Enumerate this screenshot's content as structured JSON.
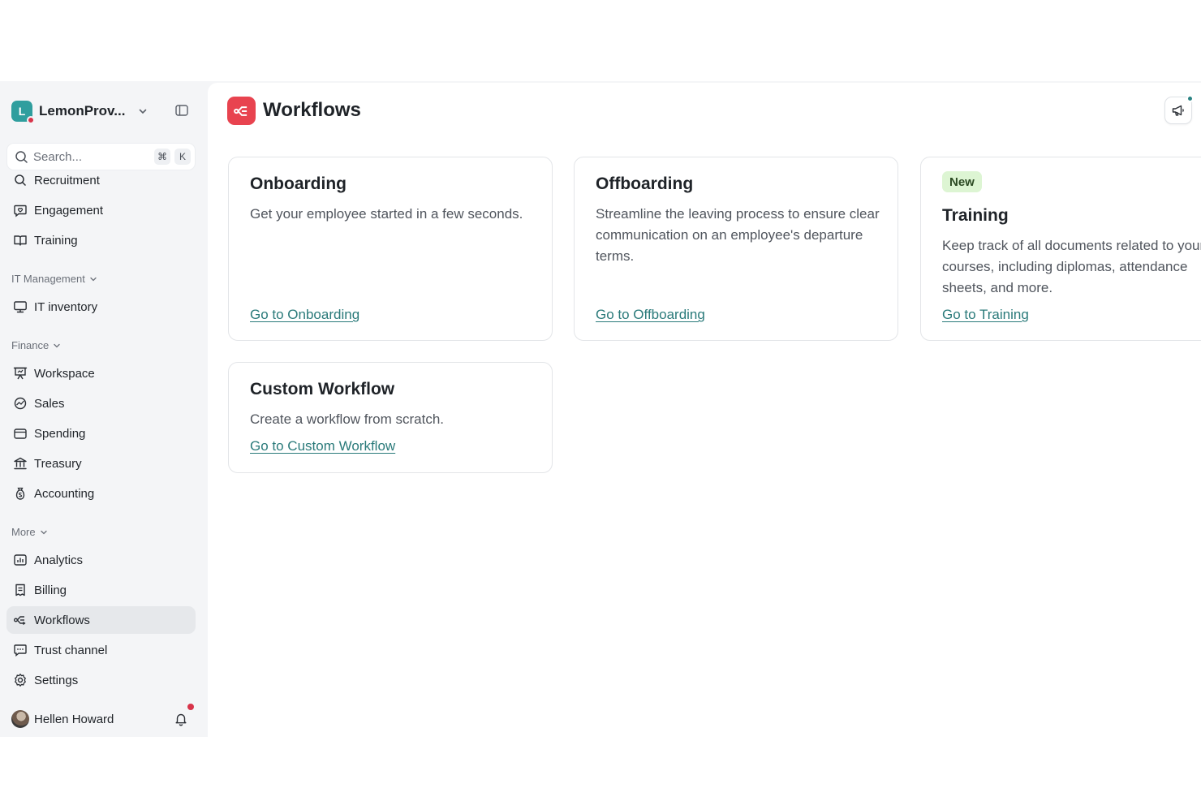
{
  "workspace": {
    "initial": "L",
    "name": "LemonProv..."
  },
  "search": {
    "placeholder": "Search...",
    "shortcut_cmd": "⌘",
    "shortcut_key": "K"
  },
  "sidebar": {
    "partial_item": {
      "label": "Recruitment",
      "icon": "recruitment-icon"
    },
    "items_top": [
      {
        "label": "Engagement",
        "icon": "engagement-icon"
      },
      {
        "label": "Training",
        "icon": "book-icon"
      }
    ],
    "sections": {
      "it_management": "IT Management",
      "finance": "Finance",
      "more": "More"
    },
    "it_items": [
      {
        "label": "IT inventory",
        "icon": "monitor-icon"
      }
    ],
    "finance_items": [
      {
        "label": "Workspace",
        "icon": "presentation-icon"
      },
      {
        "label": "Sales",
        "icon": "sales-icon"
      },
      {
        "label": "Spending",
        "icon": "wallet-icon"
      },
      {
        "label": "Treasury",
        "icon": "bank-icon"
      },
      {
        "label": "Accounting",
        "icon": "coin-icon"
      }
    ],
    "more_items": [
      {
        "label": "Analytics",
        "icon": "chart-icon"
      },
      {
        "label": "Billing",
        "icon": "receipt-icon"
      },
      {
        "label": "Workflows",
        "icon": "workflow-icon",
        "active": true
      },
      {
        "label": "Trust channel",
        "icon": "chat-icon"
      },
      {
        "label": "Settings",
        "icon": "gear-icon"
      }
    ]
  },
  "user": {
    "name": "Hellen Howard"
  },
  "page": {
    "title": "Workflows"
  },
  "cards": {
    "onboarding": {
      "title": "Onboarding",
      "description": "Get your employee started in a few seconds.",
      "link": "Go to Onboarding"
    },
    "offboarding": {
      "title": "Offboarding",
      "description": "Streamline the leaving process to ensure clear communication on an employee's departure terms.",
      "link": "Go to Offboarding"
    },
    "training": {
      "badge": "New",
      "title": "Training",
      "description": "Keep track of all documents related to your courses, including diplomas, attendance sheets, and more.",
      "link": "Go to Training"
    },
    "custom": {
      "title": "Custom Workflow",
      "description": "Create a workflow from scratch.",
      "link": "Go to Custom Workflow"
    }
  },
  "colors": {
    "accent": "#2a7a7a",
    "brand_red": "#e8434f",
    "workspace_logo": "#2f9e9e",
    "notification": "#d8344a",
    "badge_bg": "#ddf5d3"
  }
}
